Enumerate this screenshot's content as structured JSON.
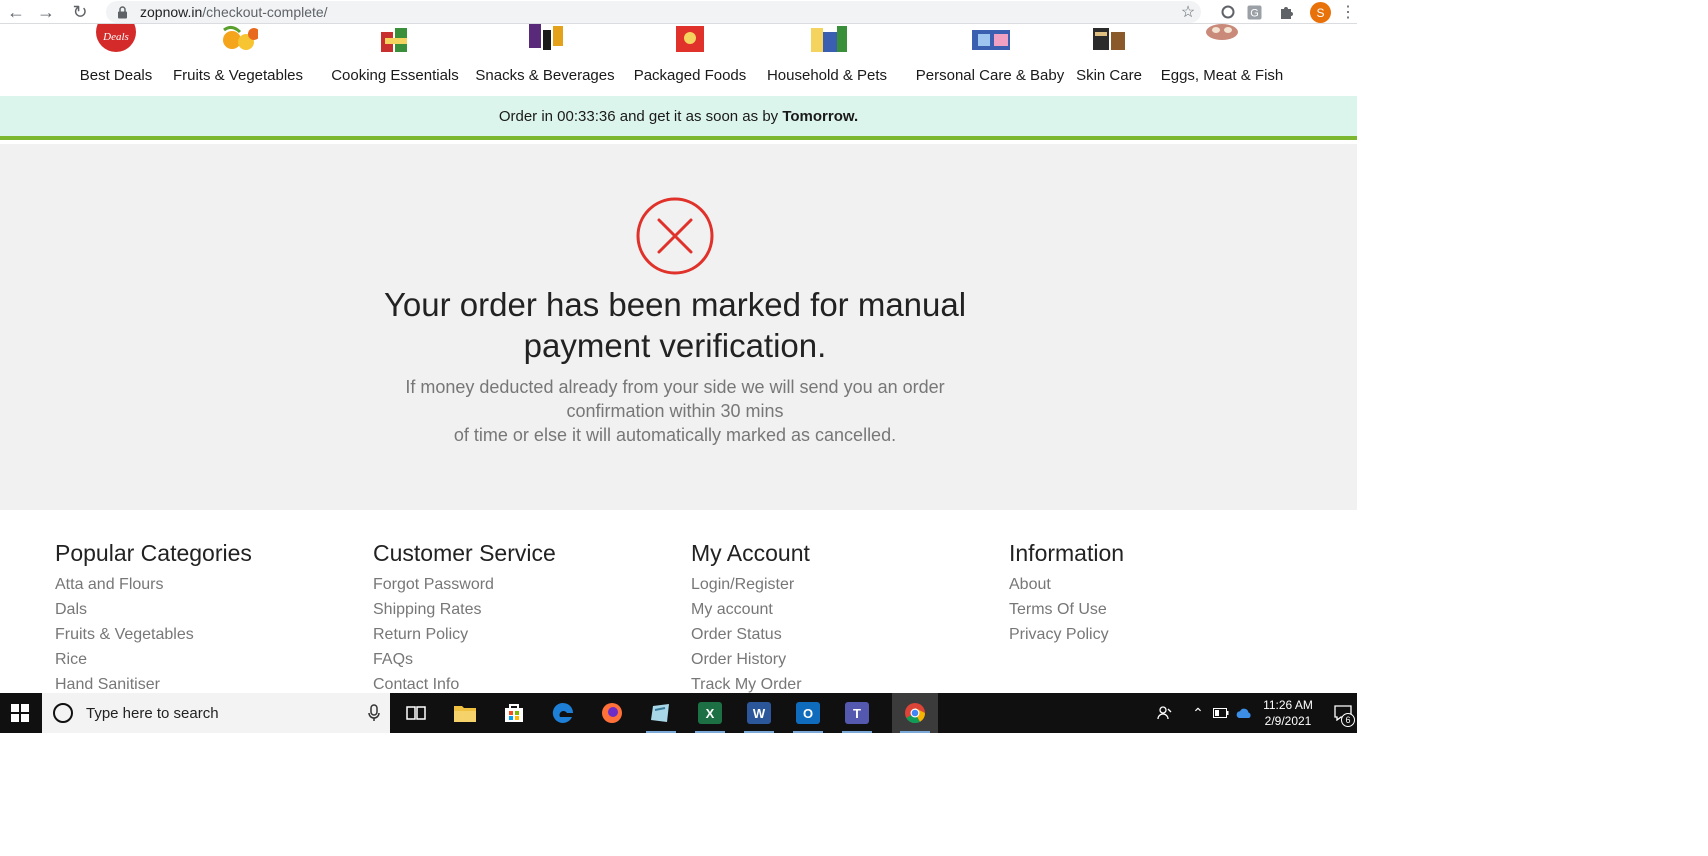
{
  "browser": {
    "url_domain": "zopnow.in",
    "url_path": "/checkout-complete/",
    "profile_initial": "S"
  },
  "categories": [
    {
      "label": "Best Deals",
      "thumb_color": "#d42a2a",
      "thumb_text": "Deals"
    },
    {
      "label": "Fruits & Vegetables",
      "thumb_color": "#f4a51c"
    },
    {
      "label": "Cooking Essentials",
      "thumb_color": "#c8302f"
    },
    {
      "label": "Snacks & Beverages",
      "thumb_color": "#5a2a7a"
    },
    {
      "label": "Packaged Foods",
      "thumb_color": "#e0312a"
    },
    {
      "label": "Household & Pets",
      "thumb_color": "#3a8f3a"
    },
    {
      "label": "Personal Care & Baby",
      "thumb_color": "#3a5fb0"
    },
    {
      "label": "Skin Care",
      "thumb_color": "#2b2b2b"
    },
    {
      "label": "Eggs, Meat & Fish",
      "thumb_color": "#c98a7a"
    }
  ],
  "banner": {
    "prefix": "Order in 00:33:36 and get it as soon as by",
    "highlight": "Tomorrow."
  },
  "message": {
    "headline_line1": "Your order has been marked for manual",
    "headline_line2": "payment verification.",
    "sub_line1": "If money deducted already from your side we will send you an order",
    "sub_line2": "confirmation within 30 mins",
    "sub_line3": "of time or else it will automatically marked as cancelled.",
    "icon": "error-x-circle-icon",
    "icon_color": "#e0312a"
  },
  "footer": {
    "popular_categories": {
      "title": "Popular Categories",
      "links": [
        "Atta and Flours",
        "Dals",
        "Fruits & Vegetables",
        "Rice",
        "Hand Sanitiser"
      ]
    },
    "customer_service": {
      "title": "Customer Service",
      "links": [
        "Forgot Password",
        "Shipping Rates",
        "Return Policy",
        "FAQs",
        "Contact Info"
      ]
    },
    "my_account": {
      "title": "My Account",
      "links": [
        "Login/Register",
        "My account",
        "Order Status",
        "Order History",
        "Track My Order"
      ]
    },
    "information": {
      "title": "Information",
      "links": [
        "About",
        "Terms Of Use",
        "Privacy Policy"
      ]
    }
  },
  "taskbar": {
    "search_placeholder": "Type here to search",
    "apps": [
      {
        "name": "task-view-icon"
      },
      {
        "name": "file-explorer-icon",
        "color": "#f0c040"
      },
      {
        "name": "store-icon",
        "color": "#ffffff"
      },
      {
        "name": "edge-icon",
        "color": "#1e7fd6"
      },
      {
        "name": "firefox-icon",
        "color": "#ff7139"
      },
      {
        "name": "app-icon",
        "color": "#a8d8e8"
      },
      {
        "name": "excel-icon",
        "color": "#1d7044",
        "glyph": "X"
      },
      {
        "name": "word-icon",
        "color": "#2b579a",
        "glyph": "W"
      },
      {
        "name": "outlook-icon",
        "color": "#0f6cbd",
        "glyph": "O"
      },
      {
        "name": "teams-icon",
        "color": "#5558af",
        "glyph": "T"
      },
      {
        "name": "chrome-icon",
        "color": "#4285f4"
      }
    ],
    "time": "11:26 AM",
    "date": "2/9/2021",
    "notification_count": "6"
  }
}
